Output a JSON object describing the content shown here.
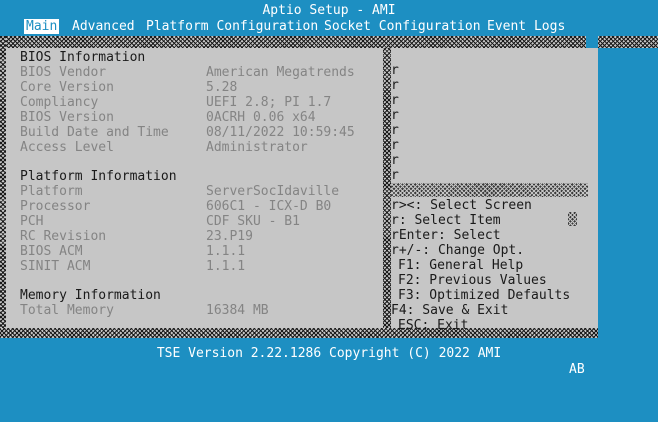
{
  "app": {
    "title": "Aptio Setup - AMI"
  },
  "tabs": [
    {
      "label": "Main",
      "active": true
    },
    {
      "label": "Advanced",
      "active": false
    },
    {
      "label": "Platform Configuration",
      "active": false
    },
    {
      "label": "Socket Configuration",
      "active": false
    },
    {
      "label": "Event Logs",
      "active": false
    }
  ],
  "bios_info": {
    "heading": "BIOS Information",
    "rows": [
      {
        "label": "BIOS Vendor",
        "value": "American Megatrends"
      },
      {
        "label": "Core Version",
        "value": "5.28"
      },
      {
        "label": "Compliancy",
        "value": "UEFI 2.8; PI 1.7"
      },
      {
        "label": "BIOS Version",
        "value": "0ACRH 0.06 x64"
      },
      {
        "label": "Build Date and Time",
        "value": "08/11/2022 10:59:45"
      },
      {
        "label": "Access Level",
        "value": "Administrator"
      }
    ]
  },
  "platform_info": {
    "heading": "Platform Information",
    "rows": [
      {
        "label": "Platform",
        "value": "ServerSocIdaville"
      },
      {
        "label": "Processor",
        "value": "606C1 - ICX-D B0"
      },
      {
        "label": "PCH",
        "value": "CDF SKU - B1"
      },
      {
        "label": "RC Revision",
        "value": "23.P19"
      },
      {
        "label": "BIOS ACM",
        "value": "1.1.1"
      },
      {
        "label": "SINIT ACM",
        "value": "1.1.1"
      }
    ]
  },
  "memory_info": {
    "heading": "Memory Information",
    "rows": [
      {
        "label": "Total Memory",
        "value": "16384 MB"
      }
    ]
  },
  "help_markers": [
    "r",
    "r",
    "r",
    "r",
    "r",
    "r",
    "r",
    "r",
    "r"
  ],
  "help_keys": [
    {
      "marker": "r",
      "text": "><: Select Screen"
    },
    {
      "marker": "r",
      "text": ": Select Item"
    },
    {
      "marker": "r",
      "text": "Enter: Select"
    },
    {
      "marker": "r",
      "text": "+/-: Change Opt."
    },
    {
      "marker": "",
      "text": "F1: General Help"
    },
    {
      "marker": "",
      "text": "F2: Previous Values"
    },
    {
      "marker": "",
      "text": "F3: Optimized Defaults"
    },
    {
      "marker": "",
      "text": "F4: Save & Exit"
    },
    {
      "marker": "",
      "text": "ESC: Exit"
    }
  ],
  "footer": {
    "text": "TSE Version 2.22.1286 Copyright (C) 2022 AMI"
  },
  "corner_label": "AB",
  "colors": {
    "background": "#1d8fc2",
    "panel": "#c6c6c6",
    "text_dark": "#1a1a1a",
    "text_gray": "#848484",
    "text_white": "#ffffff"
  }
}
